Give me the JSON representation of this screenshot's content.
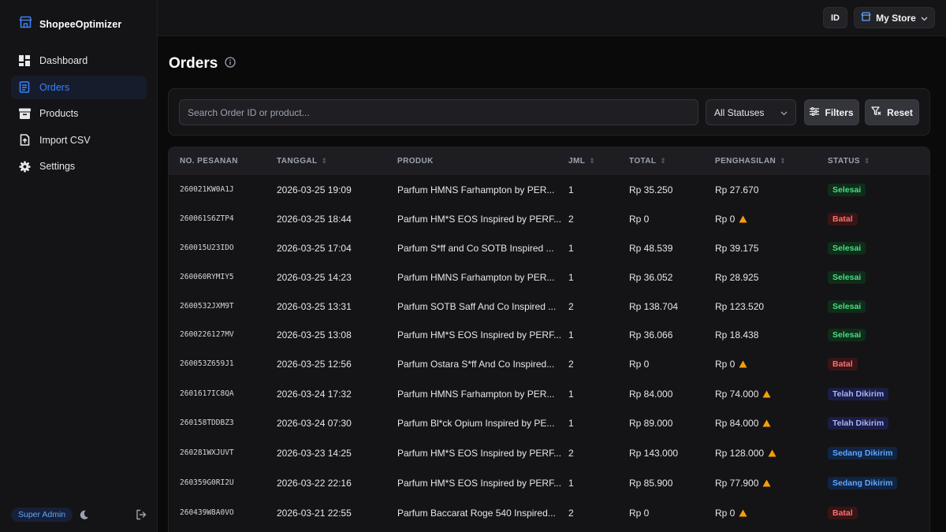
{
  "app": {
    "name": "ShopeeOptimizer"
  },
  "sidebar": {
    "items": [
      {
        "label": "Dashboard",
        "icon": "dashboard-icon"
      },
      {
        "label": "Orders",
        "icon": "orders-icon",
        "active": true
      },
      {
        "label": "Products",
        "icon": "archive-box-icon"
      },
      {
        "label": "Import CSV",
        "icon": "file-upload-icon"
      },
      {
        "label": "Settings",
        "icon": "gear-icon"
      }
    ],
    "role": "Super Admin"
  },
  "topbar": {
    "lang": "ID",
    "store": "My Store"
  },
  "page": {
    "title": "Orders"
  },
  "filters": {
    "search_placeholder": "Search Order ID or product...",
    "status_selected": "All Statuses",
    "filters_label": "Filters",
    "reset_label": "Reset"
  },
  "table": {
    "headers": [
      "NO. PESANAN",
      "TANGGAL",
      "PRODUK",
      "JML",
      "TOTAL",
      "PENGHASILAN",
      "STATUS"
    ],
    "rows": [
      {
        "id": "260021KW0A1J",
        "date": "2026-03-25 19:09",
        "product": "Parfum HMNS Farhampton by PER...",
        "qty": "1",
        "total": "Rp 35.250",
        "income": "Rp 27.670",
        "warn": false,
        "status": "Selesai",
        "tone": "green"
      },
      {
        "id": "260061S6ZTP4",
        "date": "2026-03-25 18:44",
        "product": "Parfum HM*S EOS Inspired by PERF...",
        "qty": "2",
        "total": "Rp 0",
        "income": "Rp 0",
        "warn": true,
        "status": "Batal",
        "tone": "red"
      },
      {
        "id": "260015U23IDO",
        "date": "2026-03-25 17:04",
        "product": "Parfum S*ff and Co SOTB Inspired ...",
        "qty": "1",
        "total": "Rp 48.539",
        "income": "Rp 39.175",
        "warn": false,
        "status": "Selesai",
        "tone": "green"
      },
      {
        "id": "260060RYMIY5",
        "date": "2026-03-25 14:23",
        "product": "Parfum HMNS Farhampton by PER...",
        "qty": "1",
        "total": "Rp 36.052",
        "income": "Rp 28.925",
        "warn": false,
        "status": "Selesai",
        "tone": "green"
      },
      {
        "id": "2600532JXM9T",
        "date": "2026-03-25 13:31",
        "product": "Parfum SOTB Saff And Co Inspired ...",
        "qty": "2",
        "total": "Rp 138.704",
        "income": "Rp 123.520",
        "warn": false,
        "status": "Selesai",
        "tone": "green"
      },
      {
        "id": "2600226127MV",
        "date": "2026-03-25 13:08",
        "product": "Parfum HM*S EOS Inspired by PERF...",
        "qty": "1",
        "total": "Rp 36.066",
        "income": "Rp 18.438",
        "warn": false,
        "status": "Selesai",
        "tone": "green"
      },
      {
        "id": "260053Z659J1",
        "date": "2026-03-25 12:56",
        "product": "Parfum Ostara S*ff And Co Inspired...",
        "qty": "2",
        "total": "Rp 0",
        "income": "Rp 0",
        "warn": true,
        "status": "Batal",
        "tone": "red"
      },
      {
        "id": "2601617IC8QA",
        "date": "2026-03-24 17:32",
        "product": "Parfum HMNS Farhampton by PER...",
        "qty": "1",
        "total": "Rp 84.000",
        "income": "Rp 74.000",
        "warn": true,
        "status": "Telah Dikirim",
        "tone": "indigo"
      },
      {
        "id": "260158TDDBZ3",
        "date": "2026-03-24 07:30",
        "product": "Parfum Bl*ck Opium Inspired by PE...",
        "qty": "1",
        "total": "Rp 89.000",
        "income": "Rp 84.000",
        "warn": true,
        "status": "Telah Dikirim",
        "tone": "indigo"
      },
      {
        "id": "260281WXJUVT",
        "date": "2026-03-23 14:25",
        "product": "Parfum HM*S EOS Inspired by PERF...",
        "qty": "2",
        "total": "Rp 143.000",
        "income": "Rp 128.000",
        "warn": true,
        "status": "Sedang Dikirim",
        "tone": "blue"
      },
      {
        "id": "260359G0RI2U",
        "date": "2026-03-22 22:16",
        "product": "Parfum HM*S EOS Inspired by PERF...",
        "qty": "1",
        "total": "Rp 85.900",
        "income": "Rp 77.900",
        "warn": true,
        "status": "Sedang Dikirim",
        "tone": "blue"
      },
      {
        "id": "260439W8A0VO",
        "date": "2026-03-21 22:55",
        "product": "Parfum Baccarat Roge 540 Inspired...",
        "qty": "2",
        "total": "Rp 0",
        "income": "Rp 0",
        "warn": true,
        "status": "Batal",
        "tone": "red"
      }
    ]
  }
}
